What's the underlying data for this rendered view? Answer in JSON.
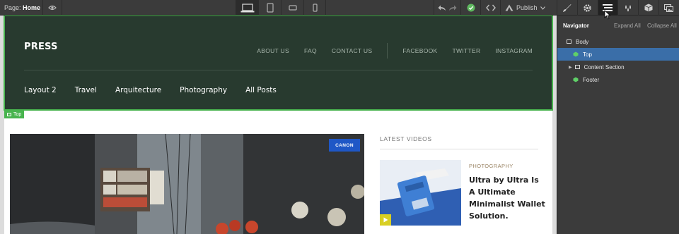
{
  "toolbar": {
    "page_label": "Page:",
    "page_name": "Home",
    "publish_label": "Publish",
    "colors": {
      "background": "#3b3b3b",
      "success": "#5fb85f"
    }
  },
  "devices": [
    {
      "name": "laptop",
      "icon": "laptop-icon",
      "active": true
    },
    {
      "name": "tablet",
      "icon": "tablet-icon",
      "active": false
    },
    {
      "name": "phone-landscape",
      "icon": "phone-landscape-icon",
      "active": false
    },
    {
      "name": "phone-portrait",
      "icon": "phone-portrait-icon",
      "active": false
    }
  ],
  "panel_tabs": [
    "brush-icon",
    "gear-icon",
    "navigator-icon",
    "drops-icon",
    "box-icon",
    "images-icon"
  ],
  "site": {
    "brand": "PRESS",
    "top_nav": [
      "ABOUT US",
      "FAQ",
      "CONTACT US"
    ],
    "social_nav": [
      "FACEBOOK",
      "TWITTER",
      "INSTAGRAM"
    ],
    "main_nav": [
      "Layout 2",
      "Travel",
      "Arquitecture",
      "Photography",
      "All Posts"
    ],
    "selection_tag": "Top",
    "featured_badge": "CANON",
    "latest_videos": {
      "title": "LATEST VIDEOS",
      "category": "PHOTOGRAPHY",
      "headline": "Ultra by Ultra Is A Ultimate Minimalist Wallet Solution."
    },
    "colors": {
      "hero_bg": "#283a2f",
      "selection": "#48b44e",
      "badge": "#1f57c6",
      "category": "#9a8464",
      "play": "#d8cf24"
    }
  },
  "navigator": {
    "title": "Navigator",
    "expand_all": "Expand All",
    "collapse_all": "Collapse All",
    "nodes": [
      {
        "label": "Body",
        "selected": false
      },
      {
        "label": "Top",
        "selected": true
      },
      {
        "label": "Content Section",
        "selected": false
      },
      {
        "label": "Footer",
        "selected": false
      }
    ],
    "selected_color": "#3a6ea8"
  }
}
